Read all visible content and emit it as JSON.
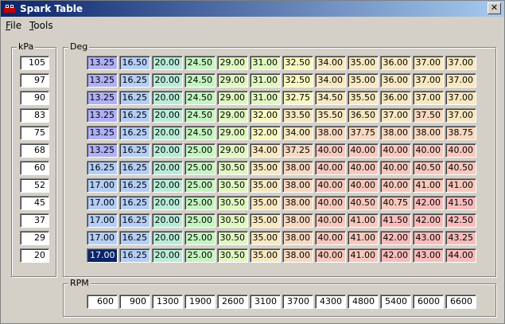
{
  "window": {
    "title": "Spark Table",
    "close_label": "✕"
  },
  "menu": [
    {
      "label": "File",
      "accel": "F",
      "rest": "ile"
    },
    {
      "label": "Tools",
      "accel": "T",
      "rest": "ools"
    }
  ],
  "kpa_group_label": "kPa",
  "deg_group_label": "Deg",
  "rpm_group_label": "RPM",
  "kpa": [
    "105",
    "97",
    "90",
    "83",
    "75",
    "68",
    "60",
    "52",
    "45",
    "37",
    "29",
    "20"
  ],
  "rpm": [
    "600",
    "900",
    "1300",
    "1900",
    "2600",
    "3100",
    "3700",
    "4300",
    "4800",
    "5400",
    "6000",
    "6600"
  ],
  "table": [
    [
      "13.25",
      "16.50",
      "20.00",
      "24.50",
      "29.00",
      "31.00",
      "32.50",
      "34.00",
      "35.00",
      "36.00",
      "37.00",
      "37.00"
    ],
    [
      "13.25",
      "16.25",
      "20.00",
      "24.50",
      "29.00",
      "31.00",
      "32.50",
      "34.00",
      "35.00",
      "36.00",
      "37.00",
      "37.00"
    ],
    [
      "13.25",
      "16.25",
      "20.00",
      "24.50",
      "29.00",
      "31.00",
      "32.75",
      "34.50",
      "35.50",
      "36.00",
      "37.00",
      "37.00"
    ],
    [
      "13.25",
      "16.25",
      "20.00",
      "24.50",
      "29.00",
      "32.00",
      "33.50",
      "35.50",
      "36.50",
      "37.00",
      "37.50",
      "37.00"
    ],
    [
      "13.25",
      "16.25",
      "20.00",
      "24.50",
      "29.00",
      "32.00",
      "34.00",
      "38.00",
      "37.75",
      "38.00",
      "38.00",
      "38.75"
    ],
    [
      "13.25",
      "16.25",
      "20.00",
      "25.00",
      "29.00",
      "34.00",
      "37.25",
      "40.00",
      "40.00",
      "40.00",
      "40.00",
      "40.00"
    ],
    [
      "16.25",
      "16.25",
      "20.00",
      "25.00",
      "30.50",
      "35.00",
      "38.00",
      "40.00",
      "40.00",
      "40.00",
      "40.50",
      "40.50"
    ],
    [
      "17.00",
      "16.25",
      "20.00",
      "25.00",
      "30.50",
      "35.00",
      "38.00",
      "40.00",
      "40.00",
      "40.00",
      "41.00",
      "41.00"
    ],
    [
      "17.00",
      "16.25",
      "20.00",
      "25.00",
      "30.50",
      "35.00",
      "38.00",
      "40.00",
      "40.50",
      "40.75",
      "42.00",
      "41.50"
    ],
    [
      "17.00",
      "16.25",
      "20.00",
      "25.00",
      "30.50",
      "35.00",
      "38.00",
      "40.00",
      "41.00",
      "41.50",
      "42.00",
      "42.50"
    ],
    [
      "17.00",
      "16.25",
      "20.00",
      "25.00",
      "30.50",
      "35.00",
      "38.00",
      "40.00",
      "41.00",
      "42.00",
      "43.00",
      "43.25"
    ],
    [
      "17.00",
      "16.25",
      "20.00",
      "25.00",
      "30.50",
      "35.00",
      "38.00",
      "40.00",
      "41.00",
      "42.00",
      "43.00",
      "44.00"
    ]
  ],
  "selected_cell": {
    "row": 11,
    "col": 0
  },
  "color_scale": [
    {
      "max": 14,
      "color": "#b0b0f8"
    },
    {
      "max": 18,
      "color": "#b4cef6"
    },
    {
      "max": 22,
      "color": "#b8ecd8"
    },
    {
      "max": 27,
      "color": "#c4f4c0"
    },
    {
      "max": 31,
      "color": "#e0f8c0"
    },
    {
      "max": 33,
      "color": "#f8f8c0"
    },
    {
      "max": 37,
      "color": "#f8e8c0"
    },
    {
      "max": 39,
      "color": "#f8d8c0"
    },
    {
      "max": 41,
      "color": "#f8c8bc"
    },
    {
      "max": 99,
      "color": "#f8bcbc"
    }
  ]
}
